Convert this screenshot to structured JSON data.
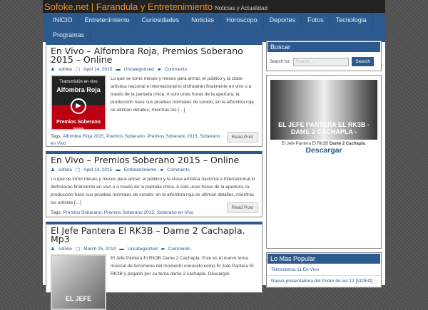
{
  "header": {
    "title": "Sofoke.net | Farandula y Entretenimiento",
    "tagline": "Noticias y Actualidad"
  },
  "nav": [
    "INICIO",
    "Entretenimiento",
    "Curiosidades",
    "Noticias",
    "Horoscopo",
    "Deportes",
    "Fotos",
    "Tecnologia",
    "Programas"
  ],
  "posts": [
    {
      "title": "En Vivo – Alfombra Roja, Premios Soberano 2015 – Online",
      "author": "sofoke",
      "date": "April 14, 2015",
      "category": "Uncategorized",
      "comments": "Comments",
      "excerpt": "Lo que se tomó meses y meses para armar, el público y la clase artística nacional e internacional lo disfrutarán finalmente en vivo o a través de la pantalla chica. A solo unas horas de la apertura, la producción hace sus pruebas normales de sonido; en la alfombra roja se ultiman detalles, mientras los […]",
      "thumb_top": "Transmisión en vivo",
      "thumb_title": "Alfombra Roja",
      "thumb_bottom": "Premios Soberano 2015",
      "tags_label": "Tags:",
      "tags": [
        "Alfombra Roja 2015",
        "Premios Soberano",
        "Premios Soberano 2015",
        "Soberano en Vivo"
      ],
      "button": "Read Post"
    },
    {
      "title": "En Vivo – Premios Soberano 2015 – Online",
      "author": "sofoke",
      "date": "April 14, 2015",
      "category": "Entretenimiento",
      "comments": "Comments",
      "excerpt": "Lo que se tomó meses y meses para armar, el público y la clase artística nacional e internacional lo disfrutarán finalmente en vivo o a través de la pantalla chica. A solo unas horas de la apertura, la producción hace sus pruebas normales de sonido; en la alfombra roja se ultiman detalles, mientras los artistas […]",
      "tags_label": "Tags:",
      "tags": [
        "Premios Soberano",
        "Premios Soberano 2015",
        "Soberano en Vivo"
      ],
      "button": "Read Post"
    },
    {
      "title": "El Jefe Pantera El RK3B – Dame 2 Cachapla. Mp3",
      "author": "sofoke",
      "date": "March 25, 2014",
      "category": "Uncategorized",
      "comments": "Comments",
      "excerpt": "El Jefe Pantera El RK3B Dame 2 Cachapla. Este es el nuevo tema musical de fenomeno del momento conocido como El Jefe Pantera El RK3B y pegado por su tema dame 2 cachapla. Descargar",
      "thumb_title": "EL JEFE"
    }
  ],
  "sidebar": {
    "search": {
      "title": "Buscar",
      "label": "Search for:",
      "placeholder": "Search ...",
      "button": "Search"
    },
    "promo": {
      "image_text": "EL JEFE PANTERA EL RK3B - DAME 2 CACHAPLA -",
      "caption": "El Jefe Pantera El RK3B",
      "caption_bold": "Dame 2 Cachapla",
      "link": "Descargar"
    },
    "popular": {
      "title": "Lo Mas Popular",
      "items": [
        "Telesistema 11 En Vivo",
        "Nueva presentadora del Poder de las 12 [VIDEO]"
      ]
    }
  }
}
